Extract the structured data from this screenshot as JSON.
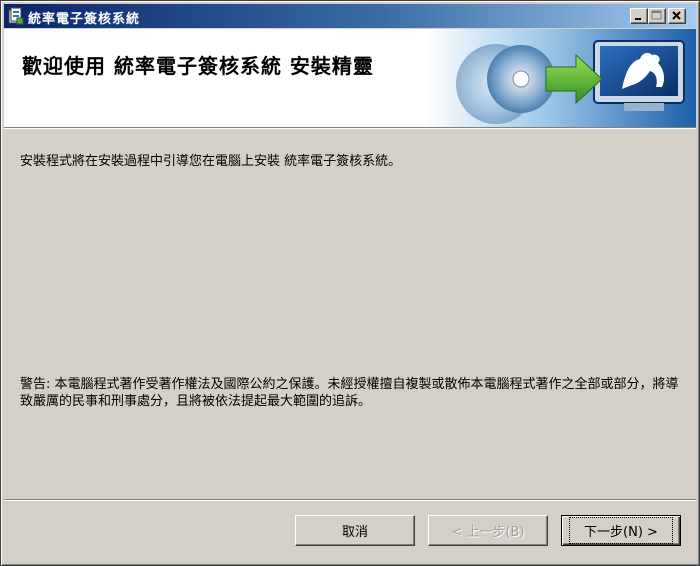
{
  "window": {
    "title": "統率電子簽核系統",
    "icon": "installer-icon"
  },
  "banner": {
    "title": "歡迎使用 統率電子簽核系統 安裝精靈"
  },
  "content": {
    "intro": "安裝程式將在安裝過程中引導您在電腦上安裝 統率電子簽核系統。",
    "warning": "警告: 本電腦程式著作受著作權法及國際公約之保護。未經授權擅自複製或散佈本電腦程式著作之全部或部分，將導致嚴厲的民事和刑事處分，且將被依法提起最大範圍的追訴。"
  },
  "buttons": {
    "cancel": "取消",
    "back": "< 上一步(B)",
    "next": "下一步(N) >"
  },
  "colors": {
    "titlebar_start": "#0a246a",
    "titlebar_end": "#a6caf0",
    "face": "#d4d0c8"
  }
}
